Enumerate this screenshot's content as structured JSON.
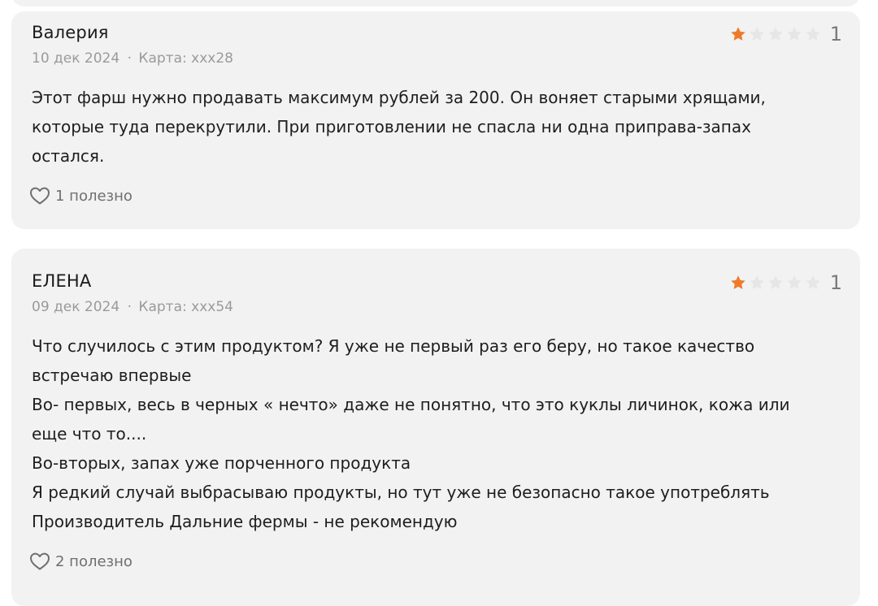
{
  "colors": {
    "card_bg": "#f2f2f2",
    "star_filled": "#f07a2b",
    "star_empty": "#e6e6e6",
    "meta_text": "#9a9a9a",
    "body_text": "#1e1e1e"
  },
  "reviews": [
    {
      "author": "Валерия",
      "date": "10 дек 2024",
      "separator": "·",
      "card": "Карта: xxx28",
      "rating": 1,
      "rating_value": "1",
      "text_lines": [
        "Этот фарш нужно продавать максимум рублей за 200. Он воняет старыми хрящами,",
        "которые туда перекрутили. При приготовлении не спасла ни одна приправа-запах",
        "остался."
      ],
      "helpful_icon": "heart-icon",
      "helpful_label": "1 полезно"
    },
    {
      "author": "ЕЛЕНА",
      "date": "09 дек 2024",
      "separator": "·",
      "card": "Карта: xxx54",
      "rating": 1,
      "rating_value": "1",
      "text_lines": [
        "Что случилось с этим продуктом? Я уже не первый раз его беру, но такое качество",
        "встречаю впервые",
        "Во- первых, весь в черных « нечто» даже не понятно, что это куклы личинок, кожа или",
        "еще что то....",
        "Во-вторых, запах уже порченного продукта",
        "Я редкий случай выбрасываю продукты, но тут уже не безопасно такое употреблять",
        "Производитель Дальние фермы - не рекомендую"
      ],
      "helpful_icon": "heart-icon",
      "helpful_label": "2 полезно"
    }
  ]
}
